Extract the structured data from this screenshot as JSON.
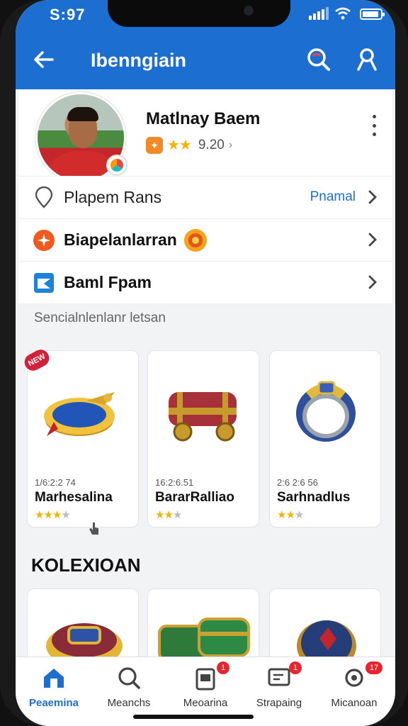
{
  "status_bar": {
    "time": "S:97"
  },
  "app_bar": {
    "title": "Ibenngiain"
  },
  "profile": {
    "name": "Matlnay Baem",
    "rating_value": "9.20",
    "rating_chevron": "›",
    "stars": "★★"
  },
  "rows": [
    {
      "label": "Plapem Rans",
      "value": "Pnamal"
    },
    {
      "label": "Biapelanlarran"
    },
    {
      "label": "Baml Fpam"
    }
  ],
  "section_caption": "Sencialnlenlanr letsan",
  "cards": [
    {
      "date": "1/6:2:2 74",
      "title": "Marhesalina",
      "stars_on": "★★★",
      "stars_off": "★"
    },
    {
      "date": "16:2:6.51",
      "title": "BararRalliao",
      "stars_on": "★★",
      "stars_off": "★"
    },
    {
      "date": "2:6 2:6 56",
      "title": "Sarhnadlus",
      "stars_on": "★★",
      "stars_off": "★"
    }
  ],
  "collection_title": "KOLEXIOAN",
  "bottom_nav": [
    {
      "label": "Peaemina",
      "badge": ""
    },
    {
      "label": "Meanchs",
      "badge": ""
    },
    {
      "label": "Meoarina",
      "badge": "1"
    },
    {
      "label": "Strapaing",
      "badge": "1"
    },
    {
      "label": "Micanoan",
      "badge": "17"
    }
  ],
  "colors": {
    "primary": "#1c6fd1",
    "star": "#f2b400",
    "badge": "#e5262f"
  },
  "icons": [
    "back-arrow-icon",
    "search-icon",
    "user-icon",
    "location-pin-icon",
    "sun-badge-icon",
    "flag-icon",
    "chevron-right-icon",
    "more-vertical-icon",
    "home-icon",
    "search-nav-icon",
    "clipboard-icon",
    "chat-icon",
    "settings-icon"
  ]
}
